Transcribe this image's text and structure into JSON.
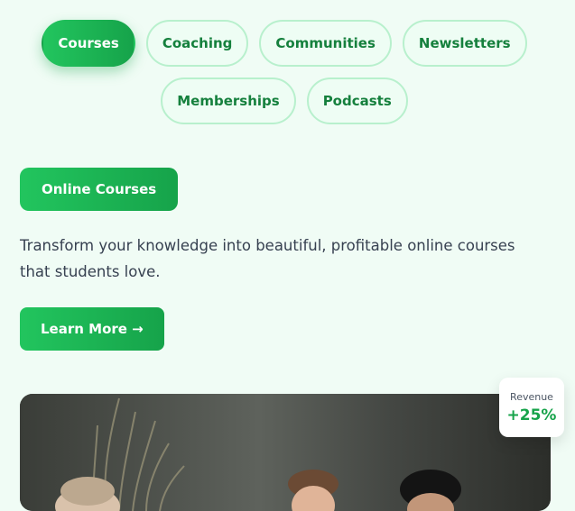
{
  "tabs": [
    {
      "label": "Courses",
      "active": true
    },
    {
      "label": "Coaching",
      "active": false
    },
    {
      "label": "Communities",
      "active": false
    },
    {
      "label": "Newsletters",
      "active": false
    },
    {
      "label": "Memberships",
      "active": false
    },
    {
      "label": "Podcasts",
      "active": false
    }
  ],
  "section": {
    "label": "Online Courses",
    "description": "Transform your knowledge into beautiful, profitable online courses that students love.",
    "cta_label": "Learn More →"
  },
  "stat_card": {
    "label": "Revenue",
    "value": "+25%"
  },
  "colors": {
    "accent": "#22c55e",
    "accent_dark": "#16a34a",
    "background": "#f0fcf5"
  }
}
